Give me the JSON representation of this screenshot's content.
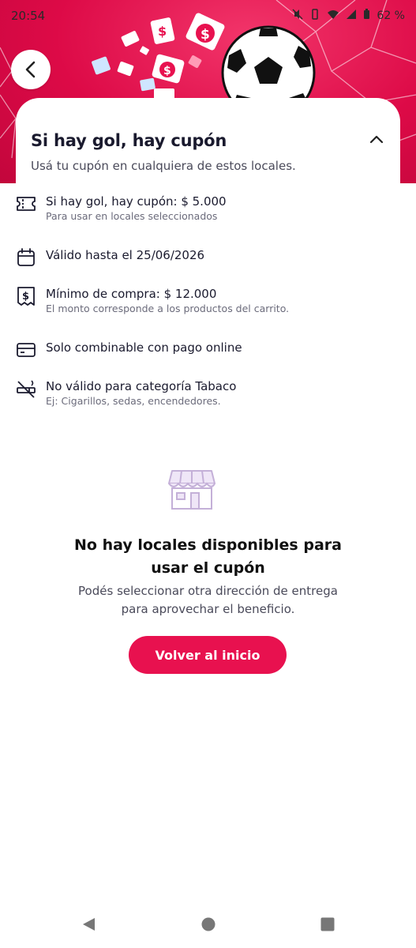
{
  "status_bar": {
    "time": "20:54",
    "battery": "62 %"
  },
  "header": {
    "back_icon": "chevron-left-icon",
    "accent_color": "#e8114f"
  },
  "coupon": {
    "title": "Si hay gol, hay cupón",
    "subtitle": "Usá tu cupón en cualquiera de estos locales.",
    "conditions": [
      {
        "icon": "ticket-icon",
        "main": "Si hay gol, hay cupón: $ 5.000",
        "sub": "Para usar en locales seleccionados"
      },
      {
        "icon": "calendar-icon",
        "main": "Válido hasta el 25/06/2026",
        "sub": ""
      },
      {
        "icon": "receipt-money-icon",
        "main": "Mínimo de compra: $ 12.000",
        "sub": "El monto corresponde a los productos del carrito."
      },
      {
        "icon": "credit-card-icon",
        "main": "Solo combinable con pago online",
        "sub": ""
      },
      {
        "icon": "no-smoking-icon",
        "main": "No válido para categoría Tabaco",
        "sub": "Ej: Cigarillos, sedas, encendedores."
      }
    ]
  },
  "empty_state": {
    "icon": "store-icon",
    "title_line1": "No hay locales disponibles para",
    "title_line2": "usar el cupón",
    "text_line1": "Podés seleccionar otra dirección de entrega",
    "text_line2": "para aprovechar el beneficio.",
    "button_label": "Volver al inicio"
  }
}
